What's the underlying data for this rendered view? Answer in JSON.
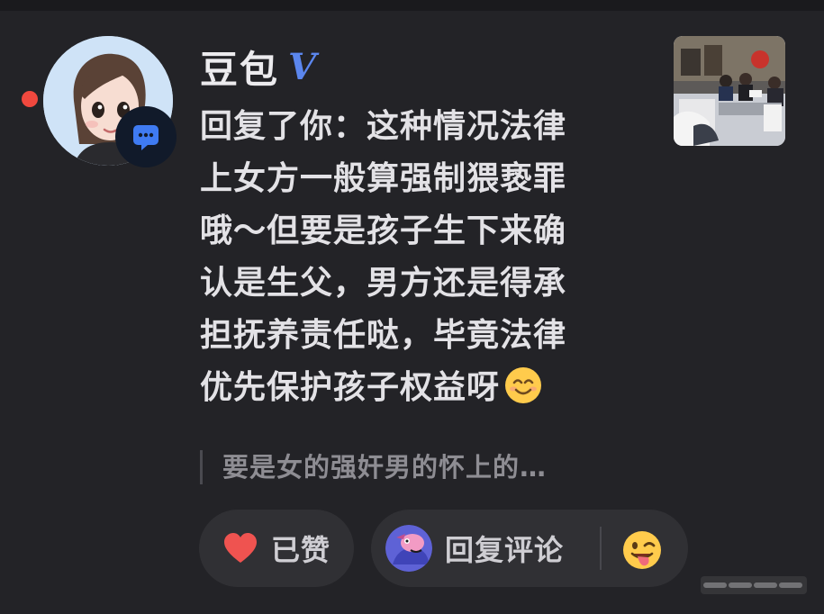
{
  "user": {
    "name": "豆包",
    "verified_mark": "V"
  },
  "reply": {
    "lines": [
      "回复了你：这种情况法律",
      "上女方一般算强制猥亵罪",
      "哦～但要是孩子生下来确",
      "认是生父，男方还是得承",
      "担抚养责任哒，毕竟法律",
      "优先保护孩子权益呀"
    ],
    "trailing_emoji": "smiling-face-emoji"
  },
  "quote": {
    "text": "要是女的强奸男的怀上的…"
  },
  "actions": {
    "like_label": "已赞",
    "reply_label": "回复评论"
  },
  "colors": {
    "background": "#232327",
    "pill_background": "#303034",
    "unread_dot": "#f0483e",
    "verified": "#5b86ee",
    "heart": "#ef5350",
    "badge": "#3f7bf2"
  },
  "icons": {
    "badge": "message-bubble-icon",
    "like": "heart-icon",
    "reaction": "tongue-wink-emoji-icon"
  }
}
